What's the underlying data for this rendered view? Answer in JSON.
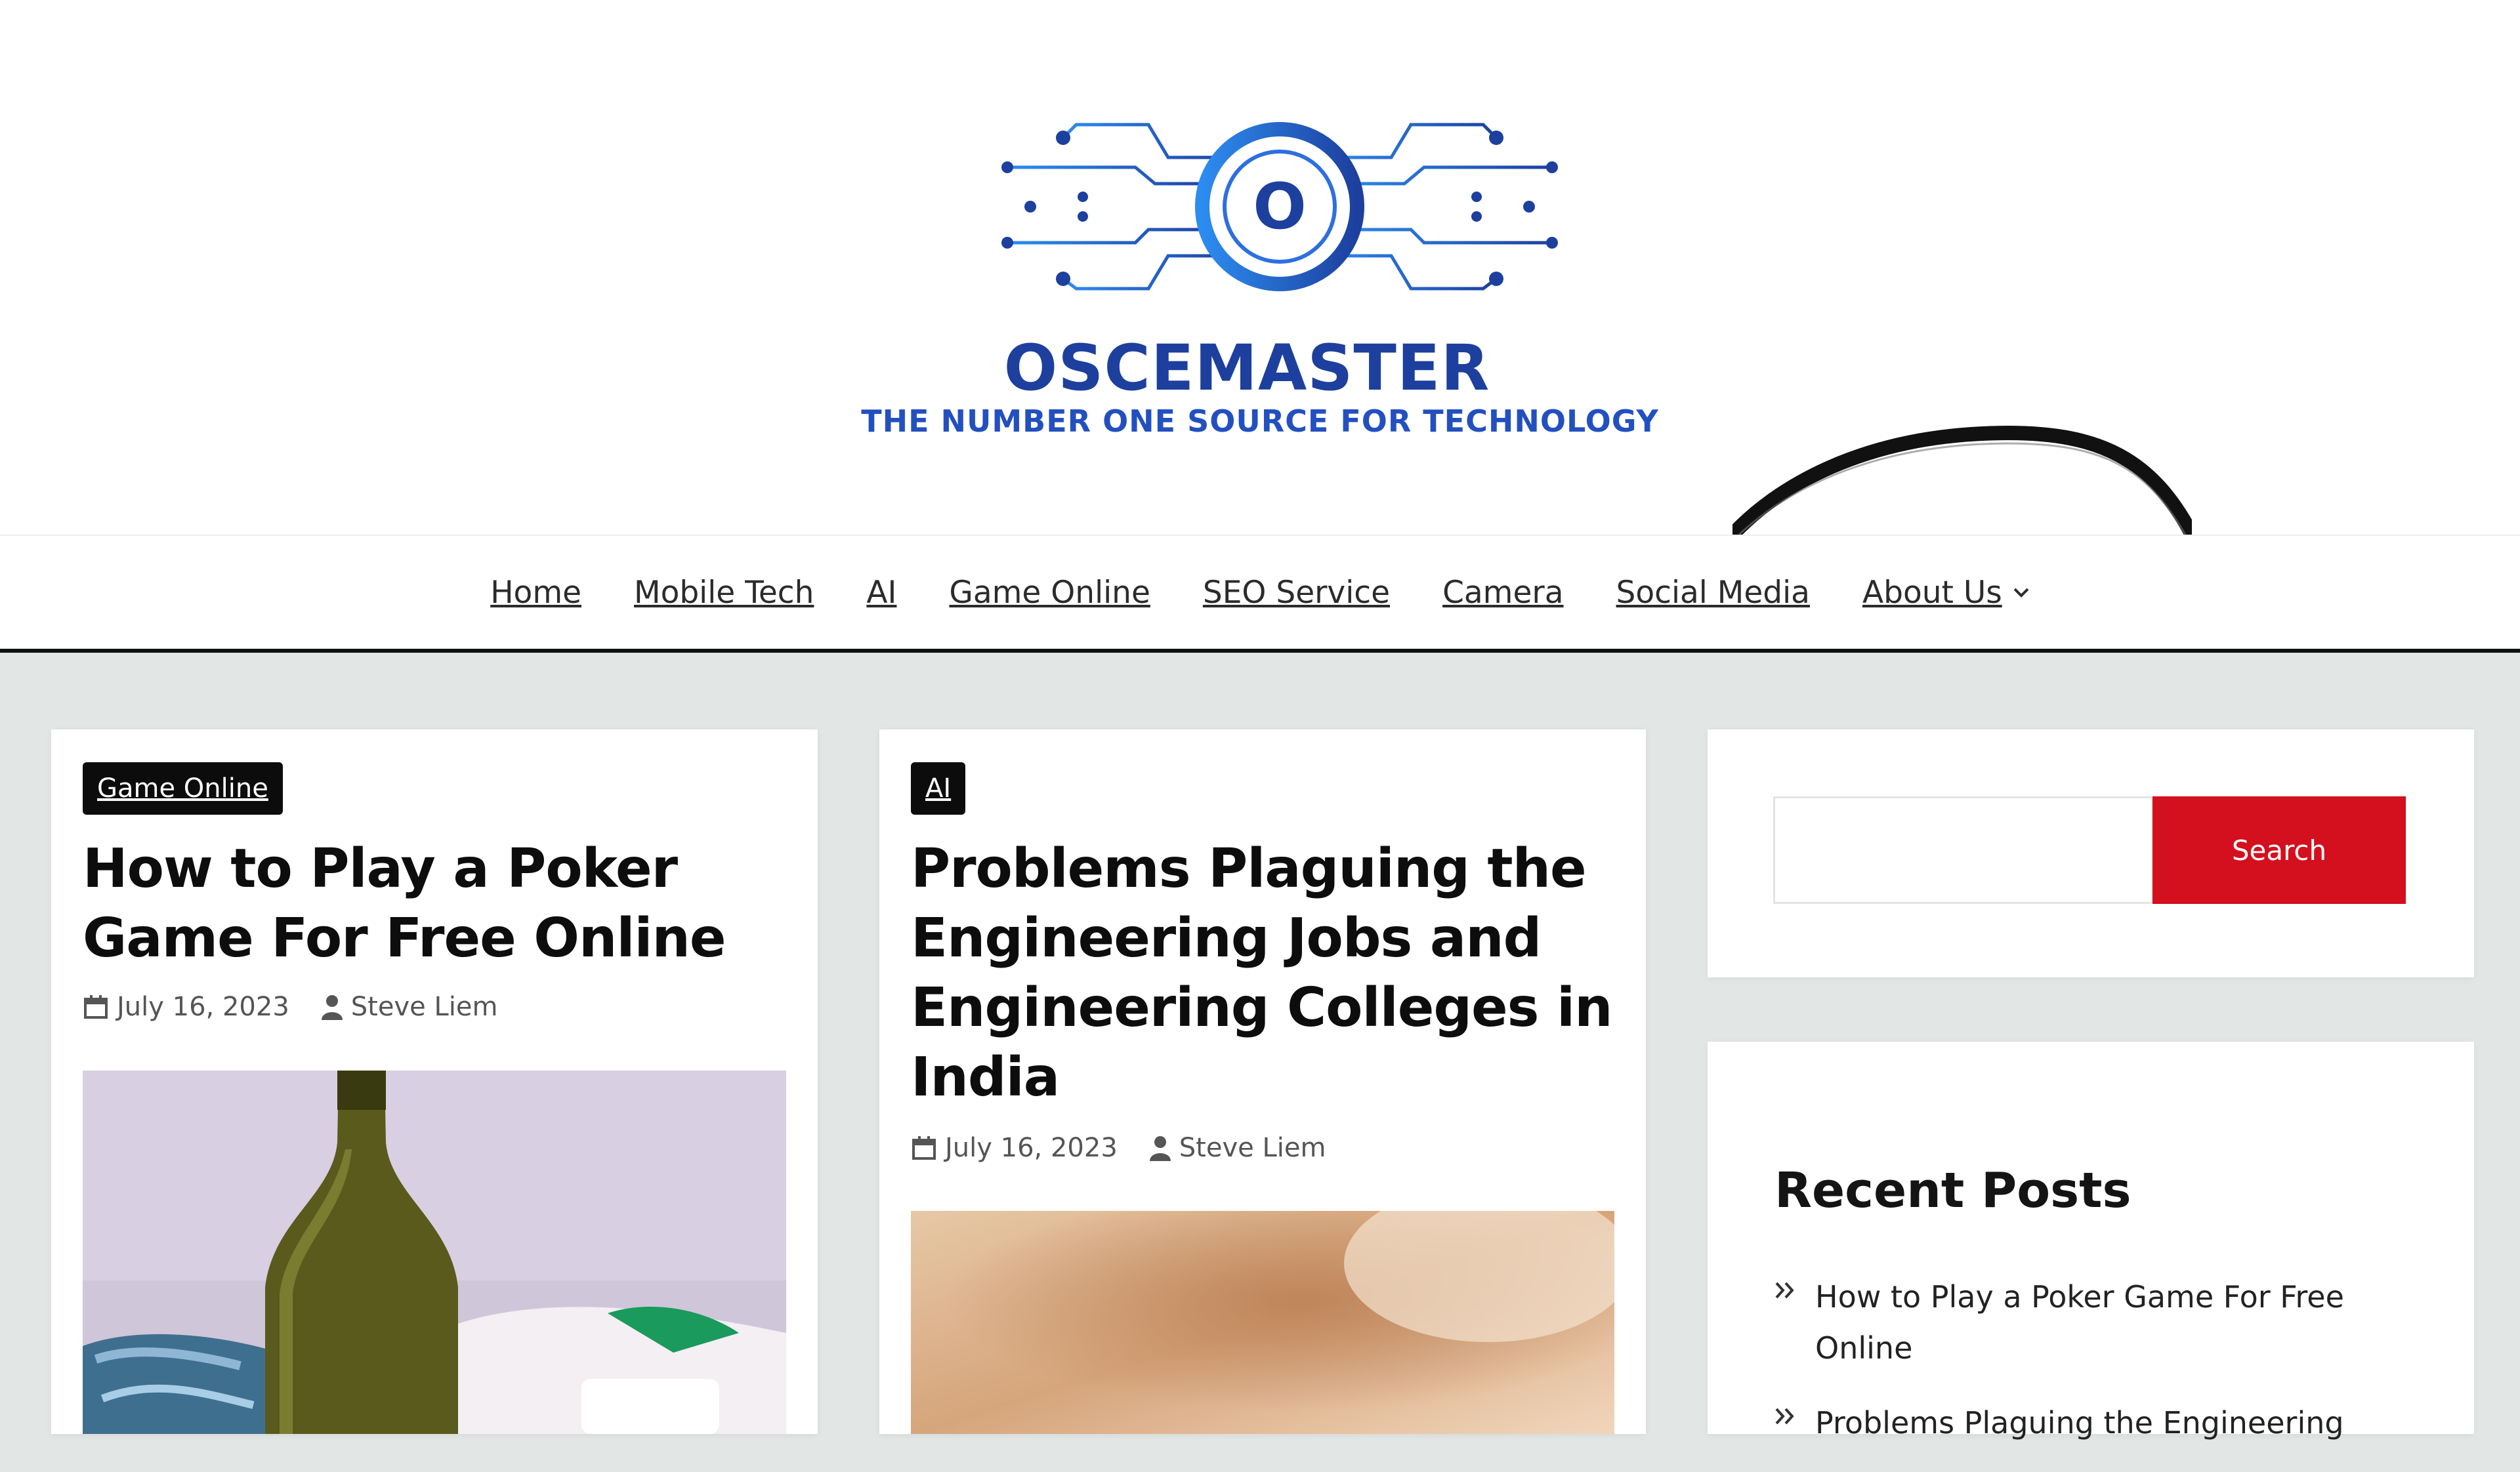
{
  "brand": {
    "name": "OSCEMASTER",
    "tagline": "THE NUMBER ONE SOURCE FOR TECHNOLOGY",
    "logo_letter": "O",
    "colors": {
      "primary": "#1d3f9e",
      "accent": "#2d7ff0"
    }
  },
  "nav": {
    "items": [
      {
        "label": "Home"
      },
      {
        "label": "Mobile Tech"
      },
      {
        "label": "AI"
      },
      {
        "label": "Game Online"
      },
      {
        "label": "SEO Service"
      },
      {
        "label": "Camera"
      },
      {
        "label": "Social Media"
      },
      {
        "label": "About Us",
        "icon": "chevron-down-icon"
      }
    ]
  },
  "posts": [
    {
      "category": "Game Online",
      "title": "How to Play a Poker Game For Free Online",
      "date": "July 16, 2023",
      "author": "Steve Liem",
      "image": "wine-bottle-photo"
    },
    {
      "category": "AI",
      "title": "Problems Plaguing the Engineering Jobs and Engineering Colleges in India",
      "date": "July 16, 2023",
      "author": "Steve Liem",
      "image": "blurred-skin-photo"
    }
  ],
  "search": {
    "button_label": "Search",
    "value": "",
    "button_color": "#d4101e"
  },
  "recent_posts": {
    "title": "Recent Posts",
    "items": [
      {
        "label": "How to Play a Poker Game For Free Online"
      },
      {
        "label": "Problems Plaguing the Engineering"
      }
    ]
  },
  "icons": {
    "date": "calendar-icon",
    "author": "user-icon",
    "recent_bullet": "double-chevron-right-icon"
  }
}
